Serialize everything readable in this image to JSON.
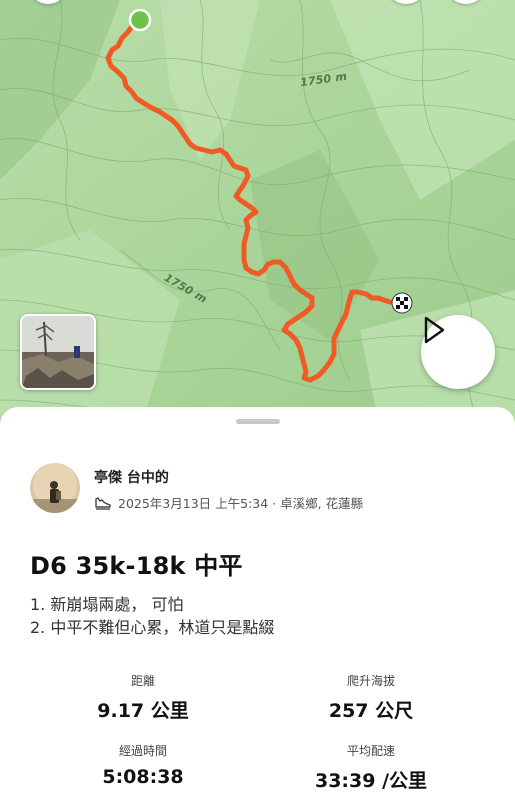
{
  "map": {
    "contour_labels": [
      "1750 m",
      "1750 m"
    ],
    "route_color": "#f05a24",
    "start_marker_color": "#6ac24a",
    "background_color": "#a9d59a"
  },
  "icons": {
    "play": "play-icon",
    "shoe": "shoe-icon",
    "finish": "checkered-flag-icon"
  },
  "user": {
    "name": "亭傑 台中的",
    "meta": "2025年3月13日 上午5:34 · 卓溪鄉, 花蓮縣"
  },
  "activity": {
    "title": "D6 35k-18k 中平",
    "description_lines": [
      "1. 新崩塌兩處， 可怕",
      "2. 中平不難但心累，林道只是點綴"
    ]
  },
  "stats": [
    {
      "label": "距離",
      "value": "9.17 公里"
    },
    {
      "label": "爬升海拔",
      "value": "257 公尺"
    },
    {
      "label": "經過時間",
      "value": "5:08:38"
    },
    {
      "label": "平均配速",
      "value": "33:39 /公里"
    }
  ]
}
